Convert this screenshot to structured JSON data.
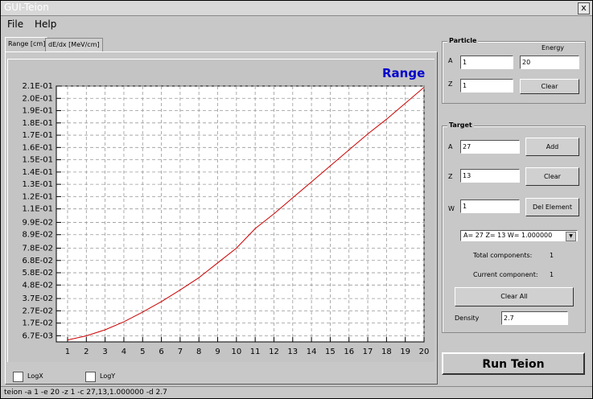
{
  "window": {
    "title": "GUI-Teion",
    "close_label": "x"
  },
  "menu": {
    "items": [
      "File",
      "Help"
    ]
  },
  "tabs": [
    "Range [cm]",
    "dE/dx [MeV/cm]"
  ],
  "plot_options": {
    "logx_label": "LogX",
    "logy_label": "LogY",
    "logx_checked": false,
    "logy_checked": false
  },
  "particle": {
    "group_title": "Particle",
    "a_label": "A",
    "a_value": "1",
    "z_label": "Z",
    "z_value": "1",
    "energy_label": "Energy",
    "energy_value": "20",
    "clear_label": "Clear"
  },
  "target": {
    "group_title": "Target",
    "a_label": "A",
    "a_value": "27",
    "z_label": "Z",
    "z_value": "13",
    "w_label": "W",
    "w_value": "1",
    "add_label": "Add",
    "clear_label": "Clear",
    "del_label": "Del Element",
    "element_selected": "A= 27  Z= 13  W= 1.000000",
    "total_label": "Total components:",
    "total_value": "1",
    "current_label": "Current component:",
    "current_value": "1",
    "clear_all_label": "Clear All",
    "density_label": "Density",
    "density_value": "2.7"
  },
  "run_label": "Run Teion",
  "status": "teion -a 1 -e 20 -z 1 -c 27,13,1.000000 -d 2.7",
  "chart_data": {
    "type": "line",
    "title": "Range",
    "title_color": "#0000cc",
    "line_color": "#cc0000",
    "grid": true,
    "xlabel": "",
    "ylabel": "",
    "x_ticks": [
      "1",
      "2",
      "3",
      "4",
      "5",
      "6",
      "7",
      "8",
      "9",
      "10",
      "11",
      "12",
      "13",
      "14",
      "15",
      "16",
      "17",
      "18",
      "19",
      "20"
    ],
    "y_ticks": [
      "6.7E-03",
      "1.7E-02",
      "2.7E-02",
      "3.7E-02",
      "4.8E-02",
      "5.8E-02",
      "6.8E-02",
      "7.8E-02",
      "8.9E-02",
      "9.9E-02",
      "1.1E-01",
      "1.2E-01",
      "1.3E-01",
      "1.4E-01",
      "1.5E-01",
      "1.6E-01",
      "1.7E-01",
      "1.8E-01",
      "1.9E-01",
      "2.0E-01",
      "2.1E-01"
    ],
    "xlim": [
      0.4,
      20
    ],
    "ylim": [
      0.0017,
      0.21
    ],
    "x": [
      1,
      2,
      3,
      4,
      5,
      6,
      7,
      8,
      9,
      10,
      11,
      12,
      13,
      14,
      15,
      16,
      17,
      18,
      19,
      20
    ],
    "y": [
      0.0033,
      0.0066,
      0.0115,
      0.018,
      0.026,
      0.0345,
      0.044,
      0.054,
      0.066,
      0.078,
      0.094,
      0.106,
      0.119,
      0.132,
      0.145,
      0.158,
      0.171,
      0.183,
      0.196,
      0.209
    ]
  }
}
